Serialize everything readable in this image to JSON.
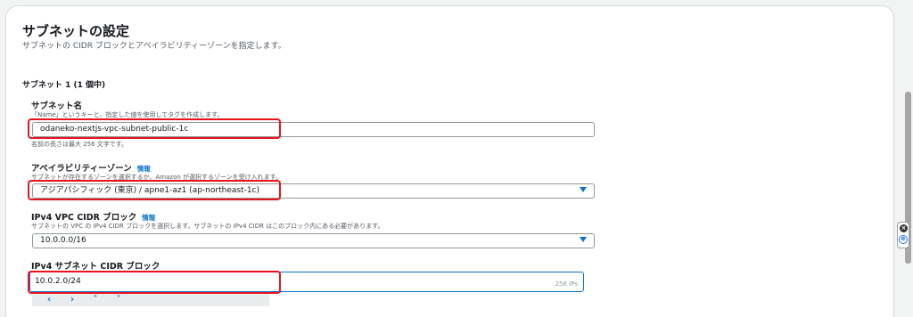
{
  "section": {
    "title": "サブネットの設定",
    "description": "サブネットの CIDR ブロックとアベイラビリティーゾーンを指定します。"
  },
  "subnet": {
    "heading": "サブネット 1 (1 個中)",
    "name_field": {
      "label": "サブネット名",
      "description": "「Name」というキーと、指定した値を使用してタグを作成します。",
      "value": "odaneko-nextjs-vpc-subnet-public-1c",
      "hint": "名前の長さは最大 256 文字です。"
    },
    "az_field": {
      "label": "アベイラビリティーゾーン",
      "info": "情報",
      "description": "サブネットが存在するゾーンを選択するか、Amazon が選択するゾーンを受け入れます。",
      "value": "アジアパシフィック (東京) / apne1-az1 (ap-northeast-1c)"
    },
    "vpc_cidr_field": {
      "label": "IPv4 VPC CIDR ブロック",
      "info": "情報",
      "description": "サブネットの VPC の IPv4 CIDR ブロックを選択します。サブネットの IPv4 CIDR はこのブロック内にある必要があります。",
      "value": "10.0.0.0/16"
    },
    "subnet_cidr_field": {
      "label": "IPv4 サブネット CIDR ブロック",
      "value": "10.0.2.0/24",
      "ip_count": "256 IPs"
    },
    "stepper": {
      "left": "‹",
      "right": "›",
      "up": "˄",
      "down": "˅"
    }
  },
  "side_widget": {
    "close_icon": "close-icon",
    "extension_icon": "e-icon",
    "close_glyph": "×",
    "ext_glyph": "e"
  },
  "colors": {
    "accent": "#0972d3",
    "highlight": "#e8141c"
  }
}
